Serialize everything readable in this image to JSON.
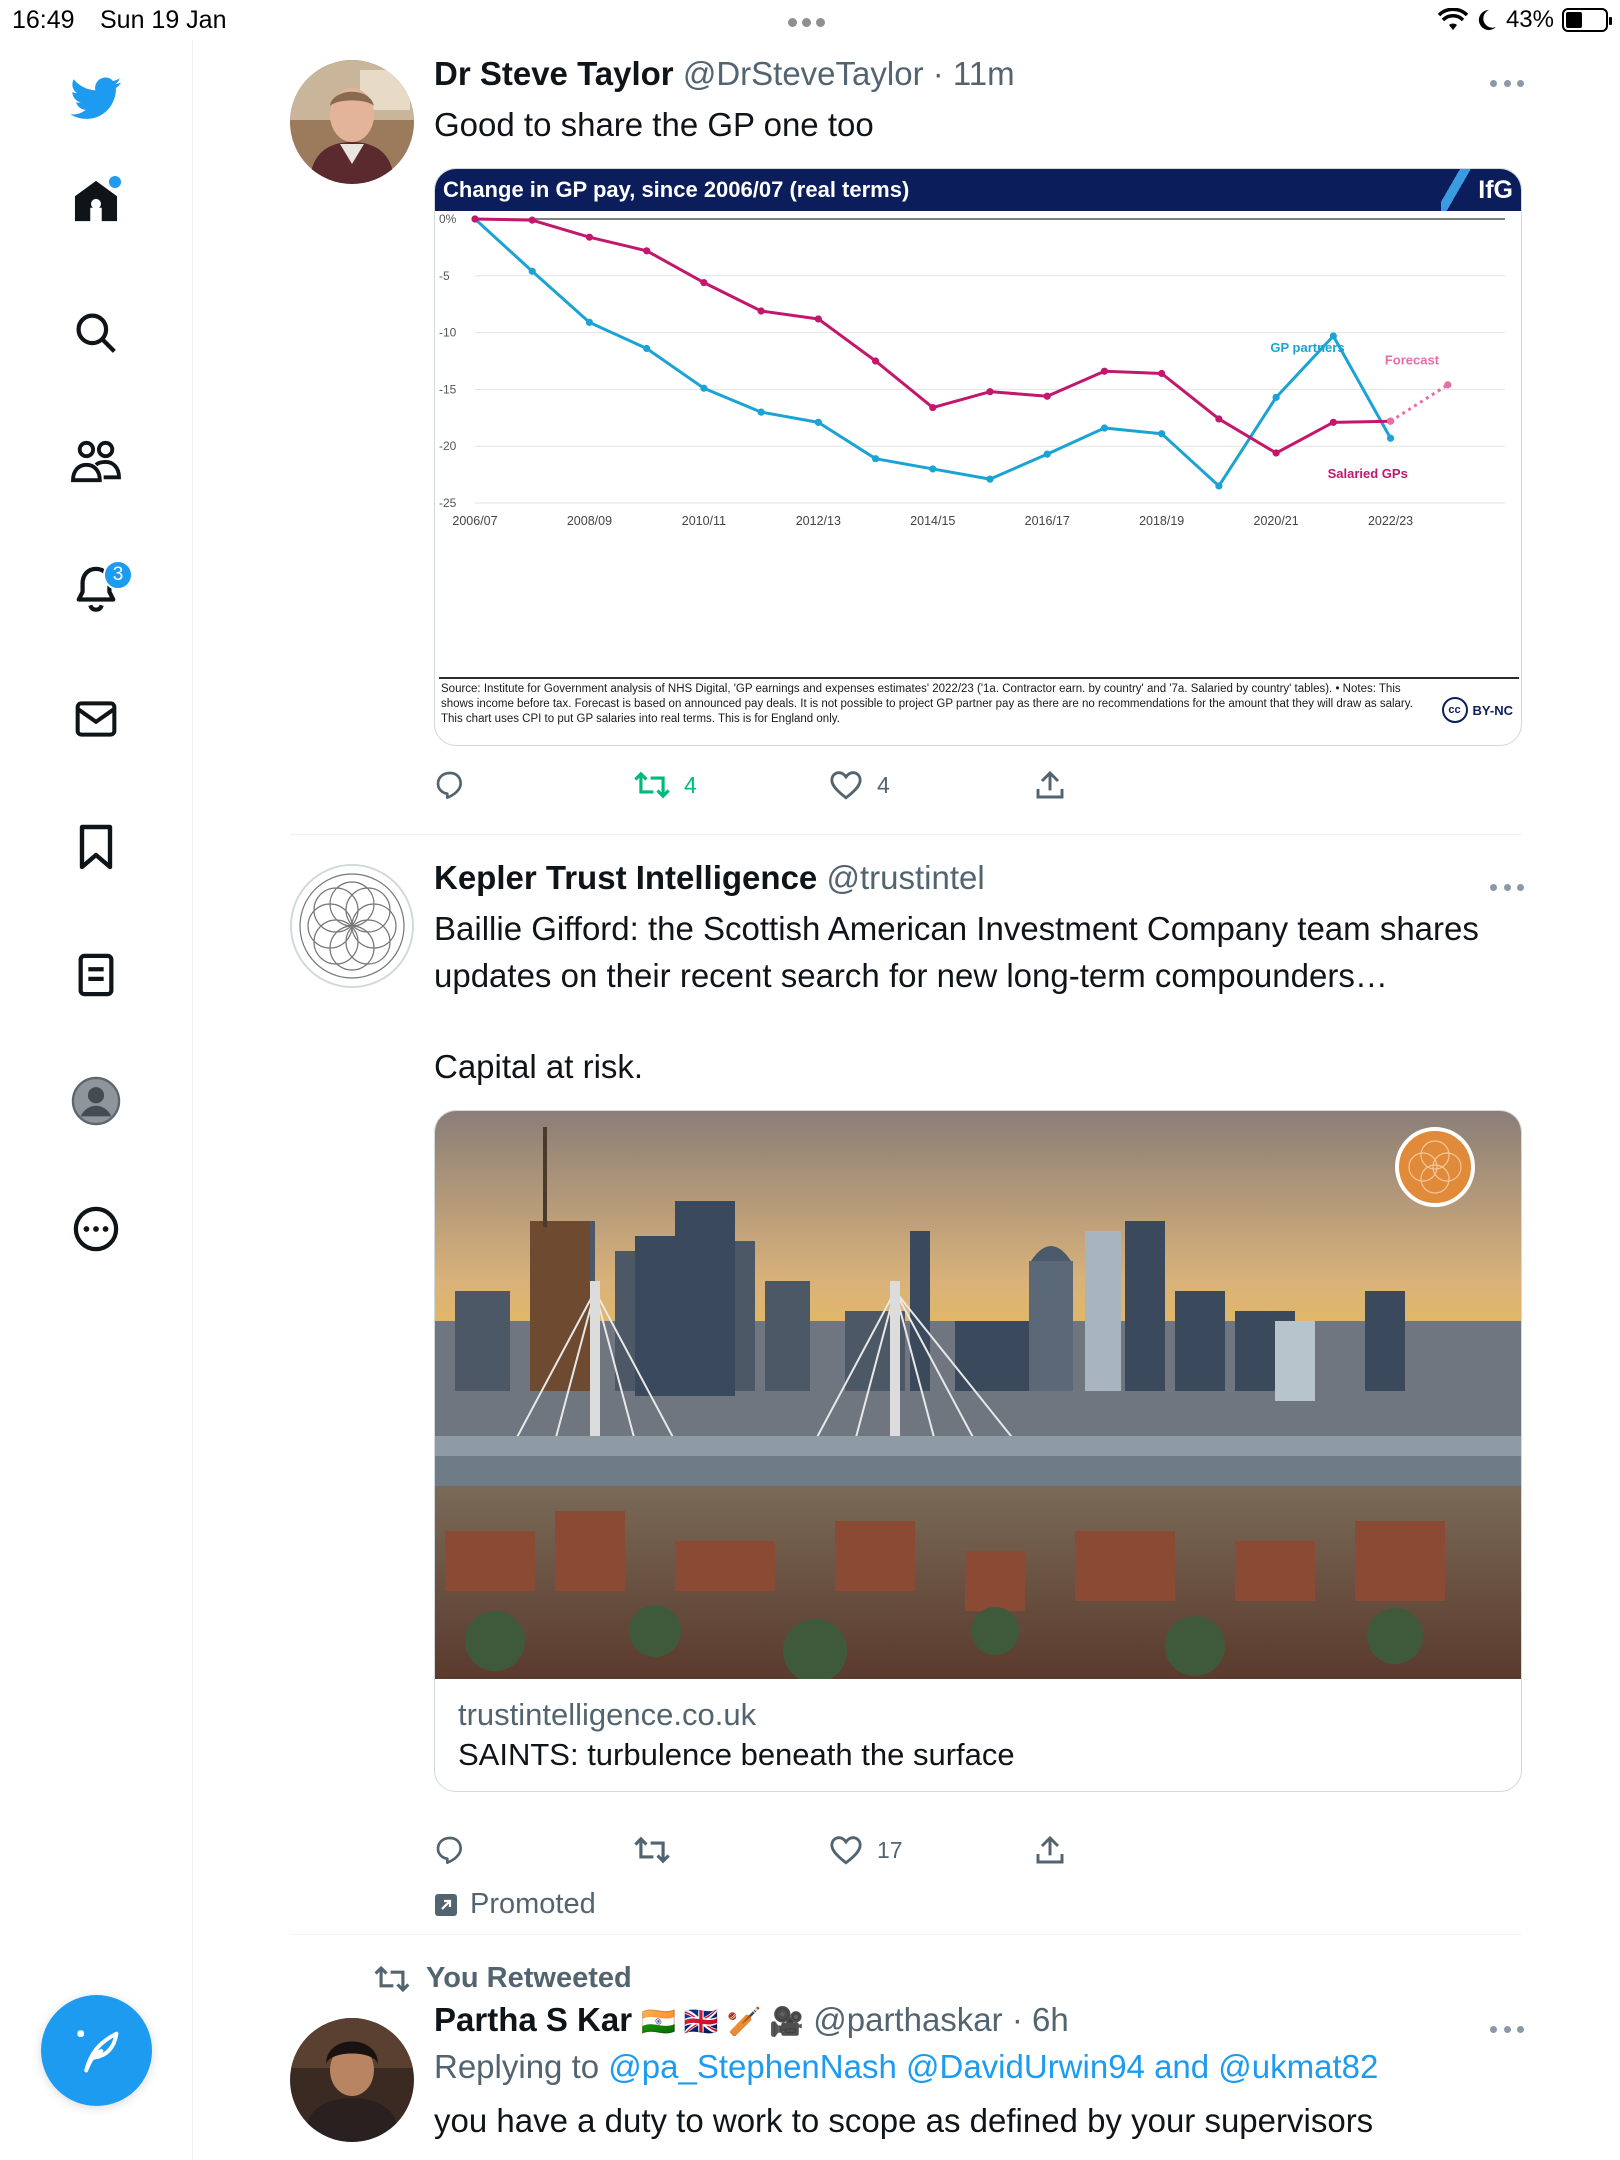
{
  "status_bar": {
    "time": "16:49",
    "date": "Sun 19 Jan",
    "battery": "43%",
    "battery_level": 0.43
  },
  "sidebar": {
    "items": [
      {
        "name": "twitter-logo",
        "label": ""
      },
      {
        "name": "home",
        "label": ""
      },
      {
        "name": "explore",
        "label": ""
      },
      {
        "name": "communities",
        "label": ""
      },
      {
        "name": "notifications",
        "label": "",
        "badge": "3"
      },
      {
        "name": "messages",
        "label": ""
      },
      {
        "name": "bookmarks",
        "label": ""
      },
      {
        "name": "lists",
        "label": ""
      },
      {
        "name": "profile",
        "label": ""
      },
      {
        "name": "more",
        "label": ""
      }
    ],
    "compose": "compose-tweet",
    "accent": "#1d9bf0"
  },
  "tweets": [
    {
      "name": "Dr Steve Taylor",
      "handle": "@DrSteveTaylor",
      "time": "· 11m",
      "text": "Good to share the GP one too",
      "chart": {
        "header": "Change in GP pay, since 2006/07 (real terms)",
        "brand": "IfG",
        "source": "Source: Institute for Government analysis of NHS Digital, 'GP earnings and expenses estimates' 2022/23 ('1a. Contractor earn. by country' and '7a. Salaried by country' tables). • Notes: This shows income before tax. Forecast is based on announced pay deals. It is not possible to project GP partner pay as there are no recommendations for the amount that they will draw as salary. This chart uses CPI to put GP salaries into real terms. This is for England only.",
        "license": "BY-NC",
        "license_icon": "cc"
      },
      "actions": {
        "replies": "",
        "retweets": "4",
        "likes": "4"
      }
    },
    {
      "name": "Kepler Trust Intelligence",
      "handle": "@trustintel",
      "time": "",
      "text_line1": "Baillie Gifford: the Scottish American Investment Company team shares",
      "text_line2": "updates on their recent search for new long-term compounders…",
      "text_line3": "Capital at risk.",
      "card": {
        "domain": "trustintelligence.co.uk",
        "title": "SAINTS: turbulence beneath the surface"
      },
      "actions": {
        "replies": "",
        "retweets": "",
        "likes": "17"
      },
      "promoted": "Promoted"
    },
    {
      "retweeted_label": "You Retweeted",
      "name": "Partha S Kar",
      "name_emoji": "🇮🇳 🇬🇧 🏏 🎥",
      "handle": "@parthaskar",
      "time": "· 6h",
      "replying_prefix": "Replying to",
      "replying_to": "@pa_StephenNash @DavidUrwin94 and @ukmat82",
      "text": "you have a duty to work to scope as defined by your supervisors"
    }
  ],
  "chart_data": {
    "type": "line",
    "title": "Change in GP pay, since 2006/07 (real terms)",
    "x_ticks": [
      "2006/07",
      "2008/09",
      "2010/11",
      "2012/13",
      "2014/15",
      "2016/17",
      "2018/19",
      "2020/21",
      "2022/23"
    ],
    "y_ticks": [
      "0%",
      "-5",
      "-10",
      "-15",
      "-20",
      "-25"
    ],
    "ylim": [
      -25,
      0
    ],
    "xlim": [
      2006,
      2024
    ],
    "grid": true,
    "series": [
      {
        "name": "GP partners",
        "color": "#1aa3d4",
        "x": [
          2006,
          2007,
          2008,
          2009,
          2010,
          2011,
          2012,
          2013,
          2014,
          2015,
          2016,
          2017,
          2018,
          2019,
          2020,
          2021,
          2022
        ],
        "y": [
          0,
          -4.6,
          -9.1,
          -11.4,
          -14.9,
          -17.0,
          -17.9,
          -21.1,
          -22.0,
          -22.9,
          -20.7,
          -18.4,
          -18.9,
          -23.5,
          -15.7,
          -10.3,
          -19.3
        ]
      },
      {
        "name": "Salaried GPs",
        "color": "#c2176c",
        "x": [
          2006,
          2007,
          2008,
          2009,
          2010,
          2011,
          2012,
          2013,
          2014,
          2015,
          2016,
          2017,
          2018,
          2019,
          2020,
          2021,
          2022
        ],
        "y": [
          0,
          -0.1,
          -1.6,
          -2.8,
          -5.6,
          -8.1,
          -8.8,
          -12.5,
          -16.6,
          -15.2,
          -15.6,
          -13.4,
          -13.6,
          -17.6,
          -20.6,
          -17.9,
          -17.8
        ]
      },
      {
        "name": "Forecast",
        "color": "#e56fa8",
        "style": "dotted",
        "x": [
          2022,
          2023
        ],
        "y": [
          -17.8,
          -14.6
        ]
      }
    ]
  }
}
